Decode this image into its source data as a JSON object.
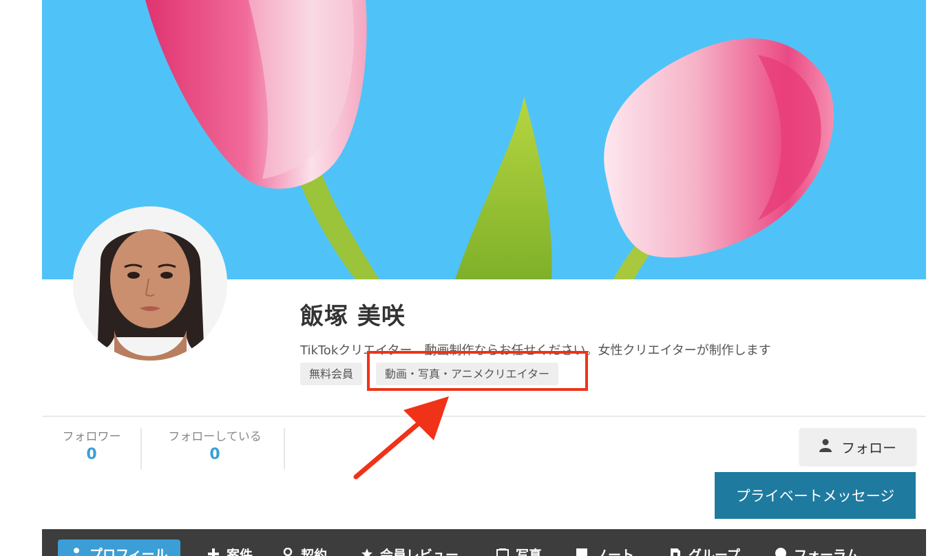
{
  "profile": {
    "name": "飯塚 美咲",
    "bio": "TikTokクリエイター　動画制作ならお任せください。女性クリエイターが制作します",
    "tags": [
      "無料会員",
      "動画・写真・アニメクリエイター"
    ]
  },
  "stats": {
    "followers_label": "フォロワー",
    "followers_count": "0",
    "following_label": "フォローしている",
    "following_count": "0"
  },
  "actions": {
    "follow_label": "フォロー",
    "private_message_label": "プライベートメッセージ"
  },
  "tabs": [
    {
      "label": "プロフィール",
      "icon": "user-icon",
      "active": true
    },
    {
      "label": "案件",
      "icon": "plus-icon"
    },
    {
      "label": "契約",
      "icon": "pin-icon"
    },
    {
      "label": "会員レビュー",
      "icon": "star-icon"
    },
    {
      "label": "写真",
      "icon": "photo-icon"
    },
    {
      "label": "ノート",
      "icon": "note-icon"
    },
    {
      "label": "グループ",
      "icon": "group-icon"
    },
    {
      "label": "フォーラム",
      "icon": "comment-icon"
    }
  ],
  "colors": {
    "cover_sky": "#4fc3f7",
    "accent_blue": "#3b9ed6",
    "message_button": "#1f7aa0",
    "annotation_red": "#f03218",
    "tabbar": "#3d3d3d"
  }
}
